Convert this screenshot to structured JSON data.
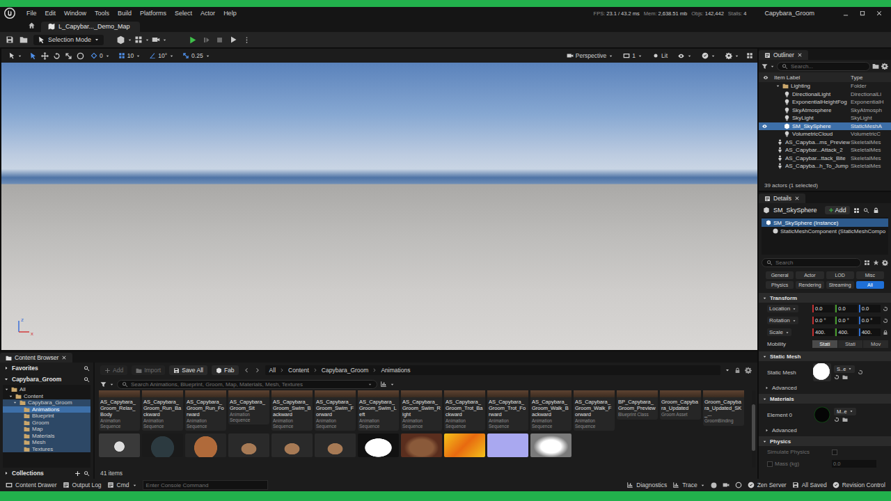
{
  "window": {
    "title": "Capybara_Groom"
  },
  "menu": [
    "File",
    "Edit",
    "Window",
    "Tools",
    "Build",
    "Platforms",
    "Select",
    "Actor",
    "Help"
  ],
  "stats": [
    {
      "label": "FPS:",
      "value": "23.1 / 43.2 ms"
    },
    {
      "label": "Mem:",
      "value": "2,638.51 mb"
    },
    {
      "label": "Objs:",
      "value": "142,442"
    },
    {
      "label": "Stalls:",
      "value": "4"
    }
  ],
  "level_tab": {
    "label": "L_Capybar..._Demo_Map",
    "selected": true
  },
  "toolbar": {
    "mode": "Selection Mode"
  },
  "viewport": {
    "snap": [
      "0",
      "10",
      "10°",
      "0.25"
    ],
    "view": "Perspective",
    "camera_speed": "1",
    "view_mode": "Lit",
    "axes": [
      "z",
      "x"
    ]
  },
  "outliner": {
    "title": "Outliner",
    "search": "Search...",
    "columns": [
      "Item Label",
      "Type"
    ],
    "folder": {
      "label": "Lighting",
      "type": "Folder",
      "expanded": true,
      "children": [
        {
          "label": "DirectionalLight",
          "type": "DirectionalLi",
          "kind": "light",
          "selected": false
        },
        {
          "label": "ExponentialHeightFog",
          "type": "ExponentialH",
          "kind": "light",
          "selected": false
        },
        {
          "label": "SkyAtmosphere",
          "type": "SkyAtmosph",
          "kind": "light",
          "selected": false
        },
        {
          "label": "SkyLight",
          "type": "SkyLight",
          "kind": "light",
          "selected": false
        },
        {
          "label": "SM_SkySphere",
          "type": "StaticMeshA",
          "kind": "mesh",
          "selected": true
        },
        {
          "label": "VolumetricCloud",
          "type": "VolumetricC",
          "kind": "light",
          "selected": false
        }
      ]
    },
    "rows": [
      {
        "label": "AS_Capyba...ms_Preview",
        "type": "SkeletalMes",
        "kind": "skeletal",
        "selected": false
      },
      {
        "label": "AS_Capybar...Attack_2",
        "type": "SkeletalMes",
        "kind": "skeletal",
        "selected": false
      },
      {
        "label": "AS_Capybar...ttack_Bite",
        "type": "SkeletalMes",
        "kind": "skeletal",
        "selected": false
      },
      {
        "label": "AS_Capyba...h_To_Jump",
        "type": "SkeletalMes",
        "kind": "skeletal",
        "selected": false
      }
    ],
    "footer": "39 actors (1 selected)"
  },
  "details": {
    "title": "Details",
    "actor": "SM_SkySphere",
    "add": "Add",
    "components": [
      {
        "label": "SM_SkySphere (Instance)",
        "selected": true
      },
      {
        "label": "StaticMeshComponent (StaticMeshCompo",
        "selected": false
      }
    ],
    "search": "Search",
    "categories": [
      {
        "label": "General",
        "selected": false
      },
      {
        "label": "Actor",
        "selected": false
      },
      {
        "label": "LOD",
        "selected": false
      },
      {
        "label": "Misc",
        "selected": false
      },
      {
        "label": "Physics",
        "selected": false
      },
      {
        "label": "Rendering",
        "selected": false
      },
      {
        "label": "Streaming",
        "selected": false
      },
      {
        "label": "All",
        "selected": true
      }
    ],
    "transform": {
      "title": "Transform",
      "rows": [
        {
          "label": "Location",
          "values": [
            "0.0",
            "0.0",
            "0.0"
          ],
          "locked": false
        },
        {
          "label": "Rotation",
          "values": [
            "0.0 °",
            "0.0 °",
            "0.0 °"
          ],
          "locked": false
        },
        {
          "label": "Scale",
          "values": [
            "400.",
            "400.",
            "400."
          ],
          "locked": true
        }
      ]
    },
    "mobility": {
      "label": "Mobility",
      "options": [
        {
          "label": "Stati",
          "selected": true
        },
        {
          "label": "Stati",
          "selected": false
        },
        {
          "label": "Mov",
          "selected": false
        }
      ]
    },
    "static_mesh": {
      "title": "Static Mesh",
      "label": "Static Mesh",
      "value": "S..e",
      "advanced": "Advanced"
    },
    "materials": {
      "title": "Materials",
      "label": "Element 0",
      "value": "M..e",
      "advanced": "Advanced"
    },
    "physics": {
      "title": "Physics",
      "rows": [
        {
          "label": "Simulate Physics",
          "kind": "checkbox",
          "checked": false,
          "disabled": true
        },
        {
          "label": "Mass (kg)",
          "kind": "number",
          "value": "0.0",
          "disabled": true
        }
      ]
    }
  },
  "content_browser": {
    "title": "Content Browser",
    "favorites": "Favorites",
    "project": "Capybara_Groom",
    "tree": [
      {
        "label": "All",
        "expanded": true,
        "selected": false,
        "children": [
          {
            "label": "Content",
            "expanded": true,
            "selected": false,
            "children": [
              {
                "label": "Capybara_Groom",
                "expanded": true,
                "selected": false,
                "children": [
                  {
                    "label": "Animations",
                    "selected": true
                  },
                  {
                    "label": "Blueprint",
                    "selected": false
                  },
                  {
                    "label": "Groom",
                    "selected": false
                  },
                  {
                    "label": "Map",
                    "selected": false
                  },
                  {
                    "label": "Materials",
                    "selected": false
                  },
                  {
                    "label": "Mesh",
                    "selected": false
                  },
                  {
                    "label": "Textures",
                    "selected": false
                  }
                ]
              }
            ]
          }
        ]
      }
    ],
    "collections": "Collections",
    "buttons": [
      {
        "label": "Add",
        "disabled": true
      },
      {
        "label": "Import",
        "disabled": true
      },
      {
        "label": "Save All",
        "disabled": false
      },
      {
        "label": "Fab",
        "disabled": false
      }
    ],
    "path": [
      "All",
      "Content",
      "Capybara_Groom",
      "Animations"
    ],
    "search": "Search Animations, Blueprint, Groom, Map, Materials, Mesh, Textures",
    "assets": [
      {
        "name": "AS_Capybara_Groom_Relax_Body",
        "type": "Animation Sequence"
      },
      {
        "name": "AS_Capybara_Groom_Run_Backward",
        "type": "Animation Sequence"
      },
      {
        "name": "AS_Capybara_Groom_Run_Forward",
        "type": "Animation Sequence"
      },
      {
        "name": "AS_Capybara_Groom_Sit",
        "type": "Animation Sequence"
      },
      {
        "name": "AS_Capybara_Groom_Swim_Backward",
        "type": "Animation Sequence"
      },
      {
        "name": "AS_Capybara_Groom_Swim_Forward",
        "type": "Animation Sequence"
      },
      {
        "name": "AS_Capybara_Groom_Swim_Left",
        "type": "Animation Sequence"
      },
      {
        "name": "AS_Capybara_Groom_Swim_Right",
        "type": "Animation Sequence"
      },
      {
        "name": "AS_Capybara_Groom_Trot_Backward",
        "type": "Animation Sequence"
      },
      {
        "name": "AS_Capybara_Groom_Trot_Forward",
        "type": "Animation Sequence"
      },
      {
        "name": "AS_Capybara_Groom_Walk_Backward",
        "type": "Animation Sequence"
      },
      {
        "name": "AS_Capybara_Groom_Walk_Forward",
        "type": "Animation Sequence"
      },
      {
        "name": "BP_Capybara_Groom_Preview",
        "type": "Blueprint Class"
      },
      {
        "name": "Groom_Capybara_Updated",
        "type": "Groom Asset"
      },
      {
        "name": "Groom_Capybara_Updated_SK_...",
        "type": "GroomBinding"
      }
    ],
    "count": "41 items"
  },
  "status_bar": {
    "left": [
      "Content Drawer",
      "Output Log",
      "Cmd"
    ],
    "console_placeholder": "Enter Console Command",
    "right": [
      "Diagnostics",
      "Trace",
      "Zen Server",
      "All Saved",
      "Revision Control"
    ]
  }
}
